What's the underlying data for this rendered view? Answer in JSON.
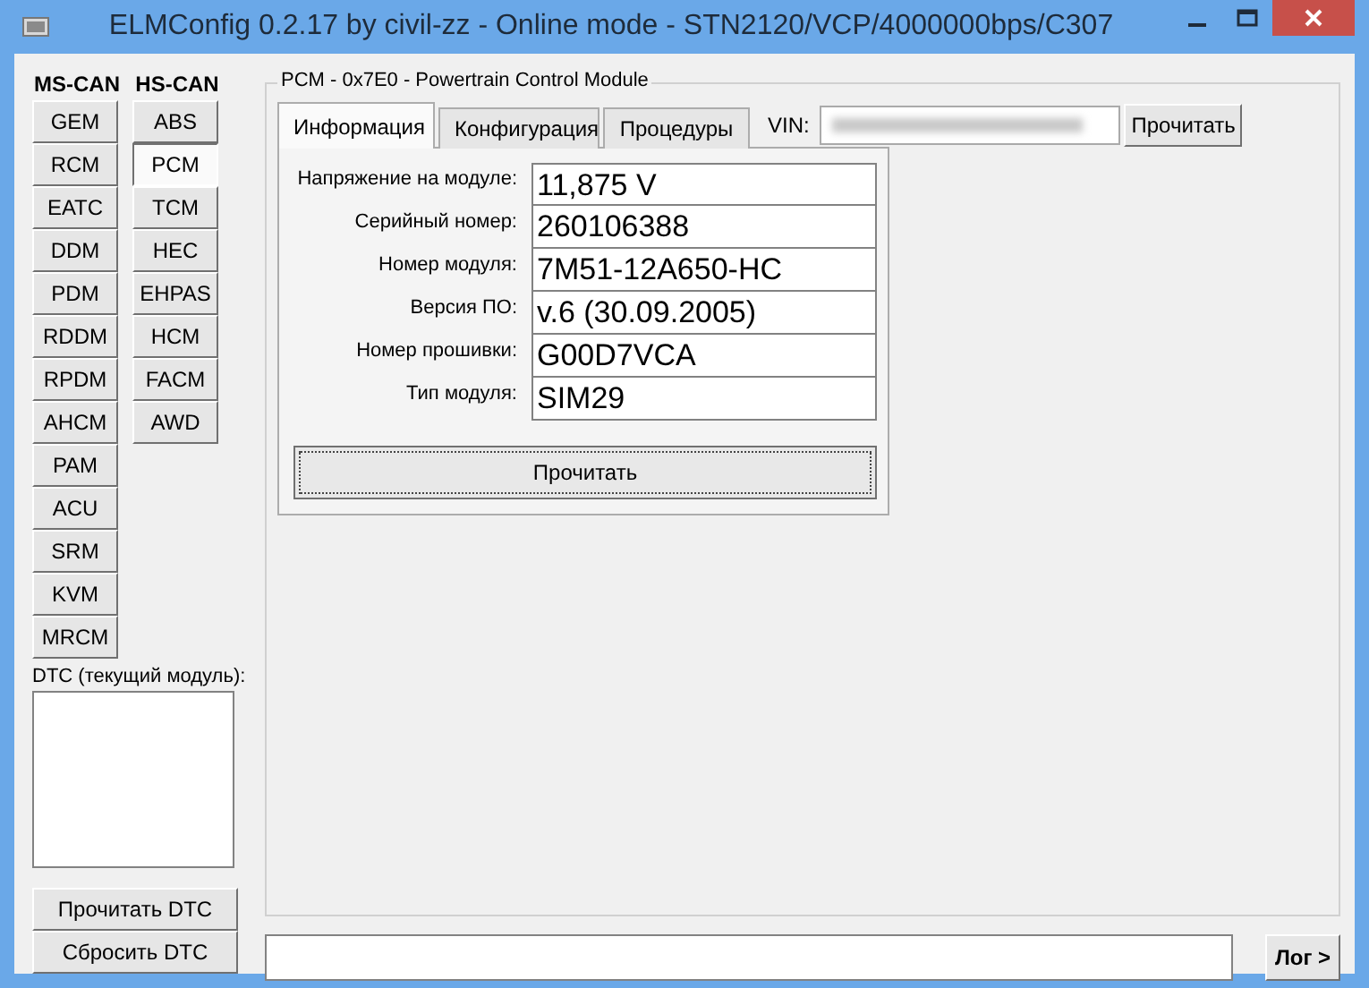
{
  "window": {
    "title": "ELMConfig 0.2.17 by civil-zz - Online mode - STN2120/VCP/4000000bps/C307"
  },
  "ms_can": {
    "label": "MS-CAN",
    "modules": [
      {
        "label": "GEM",
        "selected": false
      },
      {
        "label": "RCM",
        "selected": false
      },
      {
        "label": "EATC",
        "selected": false
      },
      {
        "label": "DDM",
        "selected": false
      },
      {
        "label": "PDM",
        "selected": false
      },
      {
        "label": "RDDM",
        "selected": false
      },
      {
        "label": "RPDM",
        "selected": false
      },
      {
        "label": "AHCM",
        "selected": false
      },
      {
        "label": "PAM",
        "selected": false
      },
      {
        "label": "ACU",
        "selected": false
      },
      {
        "label": "SRM",
        "selected": false
      },
      {
        "label": "KVM",
        "selected": false
      },
      {
        "label": "MRCM",
        "selected": false
      }
    ]
  },
  "hs_can": {
    "label": "HS-CAN",
    "modules": [
      {
        "label": "ABS",
        "selected": false
      },
      {
        "label": "PCM",
        "selected": true
      },
      {
        "label": "TCM",
        "selected": false
      },
      {
        "label": "HEC",
        "selected": false
      },
      {
        "label": "EHPAS",
        "selected": false
      },
      {
        "label": "HCM",
        "selected": false
      },
      {
        "label": "FACM",
        "selected": false
      },
      {
        "label": "AWD",
        "selected": false
      }
    ]
  },
  "dtc": {
    "label": "DTC (текущий модуль):",
    "buttons": [
      "Прочитать DTC",
      "Сбросить DTC"
    ]
  },
  "module_group": {
    "title": "PCM - 0x7E0 - Powertrain Control Module",
    "tabs": [
      {
        "label": "Информация",
        "selected": true
      },
      {
        "label": "Конфигурация",
        "selected": false
      },
      {
        "label": "Процедуры",
        "selected": false
      }
    ],
    "vin": {
      "label": "VIN:",
      "button": "Прочитать"
    },
    "info": [
      {
        "label": "Напряжение на модуле:",
        "value": "11,875 V"
      },
      {
        "label": "Серийный номер:",
        "value": "260106388"
      },
      {
        "label": "Номер модуля:",
        "value": "7M51-12A650-HC"
      },
      {
        "label": "Версия ПО:",
        "value": "v.6 (30.09.2005)"
      },
      {
        "label": "Номер прошивки:",
        "value": "G00D7VCA"
      },
      {
        "label": "Тип модуля:",
        "value": "SIM29"
      }
    ],
    "read_button": "Прочитать"
  },
  "log_button": "Лог >"
}
